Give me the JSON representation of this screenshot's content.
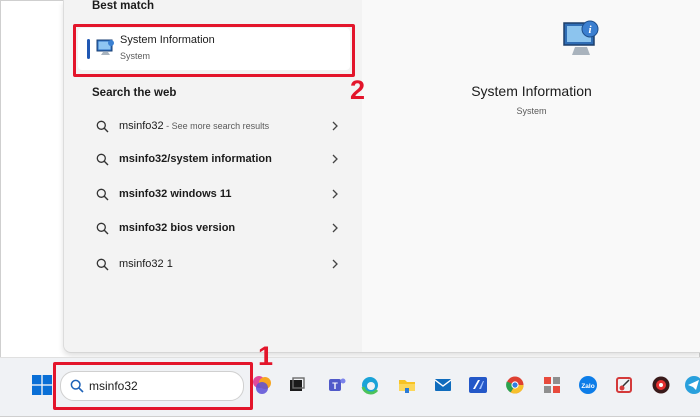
{
  "start_menu": {
    "best_match_heading": "Best match",
    "best_match": {
      "title": "System Information",
      "subtitle": "System"
    },
    "search_web_heading": "Search the web",
    "web_results": [
      {
        "query": "msinfo32",
        "suffix": " - See more search results",
        "bold": false
      },
      {
        "query": "msinfo32/system information",
        "suffix": "",
        "bold": true
      },
      {
        "query": "msinfo32 windows 11",
        "suffix": "",
        "bold": true
      },
      {
        "query": "msinfo32 bios version",
        "suffix": "",
        "bold": true
      },
      {
        "query": "msinfo32 1",
        "suffix": "",
        "bold": false
      }
    ],
    "detail": {
      "title": "System Information",
      "subtitle": "System"
    }
  },
  "annotations": {
    "step1": "1",
    "step2": "2",
    "color": "#e3152b"
  },
  "taskbar": {
    "search_value": "msinfo32",
    "icons": [
      "windows-icon",
      "copilot-icon",
      "task-view-icon",
      "teams-icon",
      "edge-icon",
      "file-explorer-icon",
      "mail-icon",
      "visual-studio-icon",
      "chrome-icon",
      "app-grid-icon",
      "zalo-icon",
      "snipping-tool-icon",
      "record-icon",
      "telegram-icon"
    ]
  }
}
